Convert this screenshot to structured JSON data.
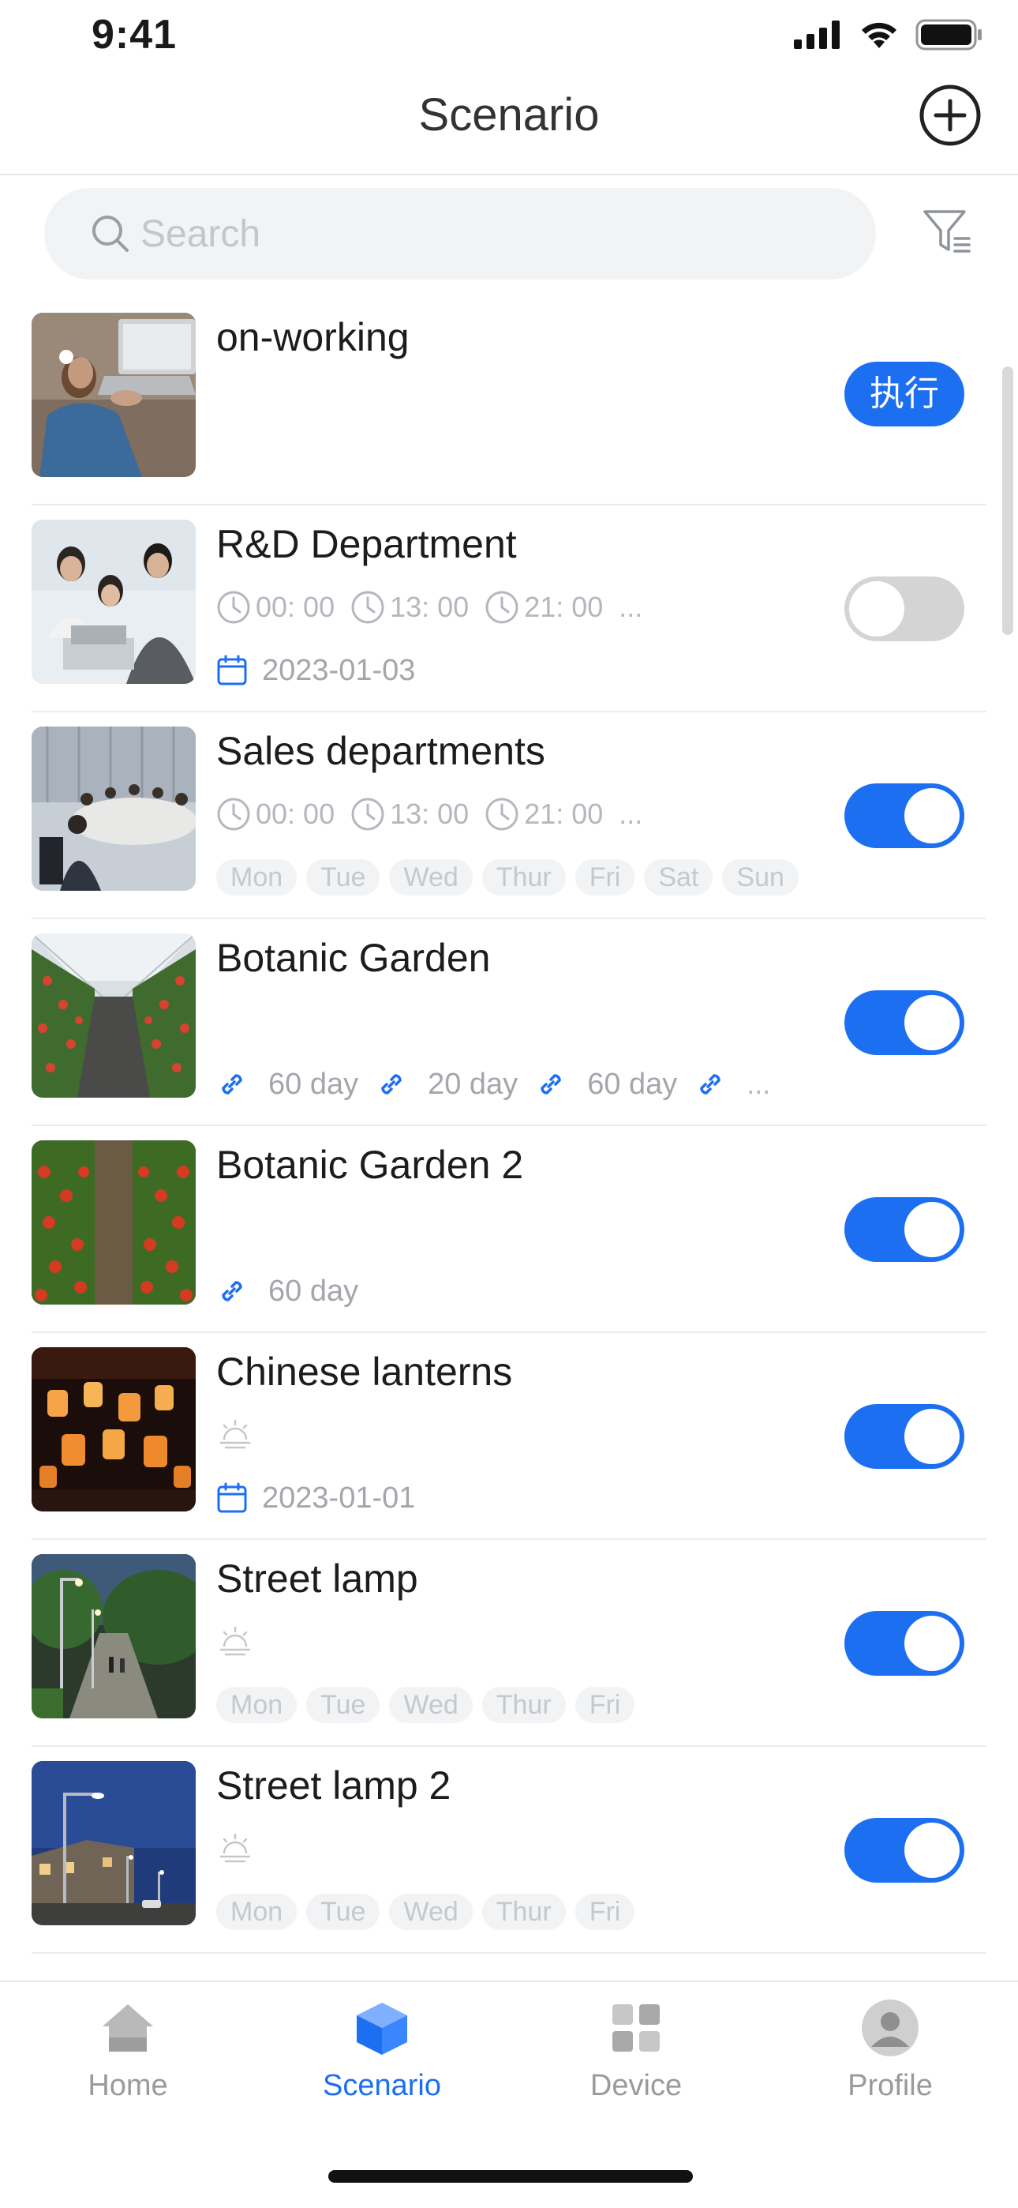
{
  "status_bar": {
    "time": "9:41"
  },
  "header": {
    "title": "Scenario"
  },
  "search": {
    "placeholder": "Search"
  },
  "colors": {
    "accent": "#1d6ff2",
    "toggle_off": "#d4d4d4",
    "muted_text": "#b4b7bd"
  },
  "scenarios": [
    {
      "title": "on-working",
      "action_label": "执行"
    },
    {
      "title": "R&D Department",
      "times": [
        "00: 00",
        "13: 00",
        "21: 00"
      ],
      "more": "...",
      "date": "2023-01-03",
      "enabled": false
    },
    {
      "title": "Sales departments",
      "times": [
        "00: 00",
        "13: 00",
        "21: 00"
      ],
      "more": "...",
      "days": [
        "Mon",
        "Tue",
        "Wed",
        "Thur",
        "Fri",
        "Sat",
        "Sun"
      ],
      "enabled": true
    },
    {
      "title": "Botanic Garden",
      "links": [
        "60 day",
        "20 day",
        "60 day"
      ],
      "more": "...",
      "enabled": true
    },
    {
      "title": "Botanic Garden 2",
      "links": [
        "60 day"
      ],
      "enabled": true
    },
    {
      "title": "Chinese lanterns",
      "date": "2023-01-01",
      "enabled": true
    },
    {
      "title": "Street lamp",
      "days": [
        "Mon",
        "Tue",
        "Wed",
        "Thur",
        "Fri"
      ],
      "enabled": true
    },
    {
      "title": "Street lamp 2",
      "days": [
        "Mon",
        "Tue",
        "Wed",
        "Thur",
        "Fri"
      ],
      "enabled": true
    }
  ],
  "tabs": [
    {
      "label": "Home",
      "icon": "home-icon",
      "active": false
    },
    {
      "label": "Scenario",
      "icon": "cube-icon",
      "active": true
    },
    {
      "label": "Device",
      "icon": "grid-icon",
      "active": false
    },
    {
      "label": "Profile",
      "icon": "user-icon",
      "active": false
    }
  ]
}
